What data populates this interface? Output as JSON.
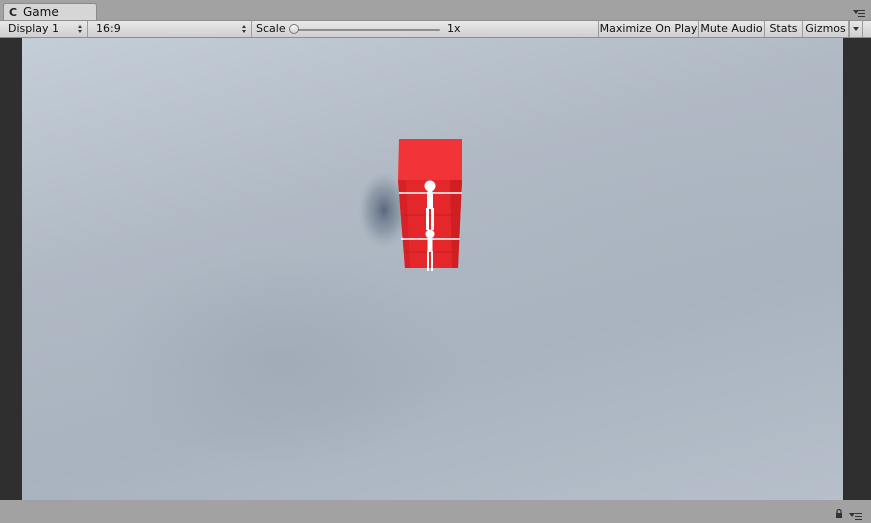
{
  "tab": {
    "glyph": "C",
    "label": "Game"
  },
  "toolbar": {
    "display_select": "Display 1",
    "aspect_select": "16:9",
    "scale_label": "Scale",
    "scale_value": "1x",
    "scale_level": 0,
    "maximize_on_play": "Maximize On Play",
    "mute_audio": "Mute Audio",
    "stats": "Stats",
    "gizmos": "Gizmos"
  },
  "icons": {
    "tab": "unity-game-icon",
    "panel_menu": "panel-menu-icon",
    "lock": "lock-icon",
    "status_menu": "panel-menu-icon"
  },
  "colors": {
    "block": "#e52227",
    "block_light": "#f03a3c",
    "sky": "#b5bec9",
    "figure": "#ffffff"
  }
}
